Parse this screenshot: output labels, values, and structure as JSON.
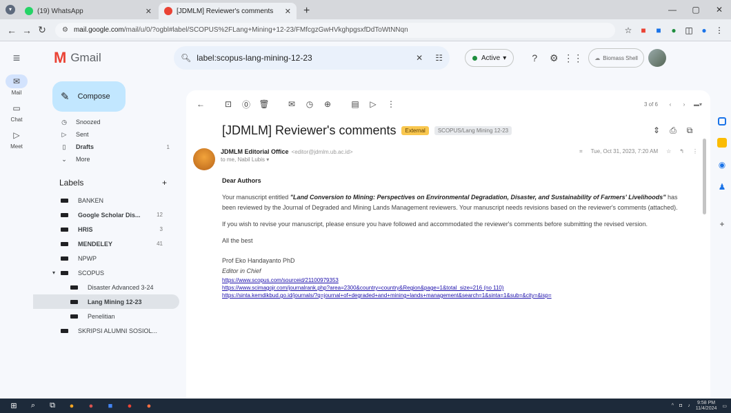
{
  "browser": {
    "tabs": [
      {
        "title": "(19) WhatsApp",
        "color": "#25d366"
      },
      {
        "title": "[JDMLM] Reviewer's comments",
        "color": "#ea4335"
      }
    ],
    "url_host": "mail.google.com",
    "url_path": "/mail/u/0/?ogbl#label/SCOPUS%2FLang+Mining+12-23/FMfcgzGwHVkghpgsxfDdToWtNNqn"
  },
  "header": {
    "logo_text": "Gmail",
    "search_query": "label:scopus-lang-mining-12-23",
    "status": "Active",
    "account_label": "Biomass Shell"
  },
  "rail": [
    {
      "label": "Mail",
      "icon": "mail-icon"
    },
    {
      "label": "Chat",
      "icon": "chat-icon"
    },
    {
      "label": "Meet",
      "icon": "video-icon"
    }
  ],
  "compose_label": "Compose",
  "nav": [
    {
      "icon": "snooze-icon",
      "label": "Snoozed",
      "count": ""
    },
    {
      "icon": "send-icon",
      "label": "Sent",
      "count": ""
    },
    {
      "icon": "draft-icon",
      "label": "Drafts",
      "count": "1"
    },
    {
      "icon": "more-icon",
      "label": "More",
      "count": ""
    }
  ],
  "labels_heading": "Labels",
  "labels": [
    {
      "name": "BANKEN",
      "count": "",
      "bold": false
    },
    {
      "name": "Google Scholar Dis...",
      "count": "12",
      "bold": true
    },
    {
      "name": "HRIS",
      "count": "3",
      "bold": true
    },
    {
      "name": "MENDELEY",
      "count": "41",
      "bold": true
    },
    {
      "name": "NPWP",
      "count": "",
      "bold": false
    },
    {
      "name": "SCOPUS",
      "count": "",
      "bold": false
    },
    {
      "name": "Disaster Advanced 3-24",
      "count": "",
      "bold": false
    },
    {
      "name": "Lang Mining 12-23",
      "count": "",
      "bold": true
    },
    {
      "name": "Penelitian",
      "count": "",
      "bold": false
    },
    {
      "name": "SKRIPSI ALUMNI SOSIOL...",
      "count": "",
      "bold": false
    }
  ],
  "email": {
    "pagination": "3 of 6",
    "subject": "[JDMLM] Reviewer's comments",
    "chip_external": "External",
    "chip_label": "SCOPUS/Lang Mining 12-23",
    "sender_name": "JDMLM Editorial Office",
    "sender_email": "<editor@jdmlm.ub.ac.id>",
    "to_line": "to me, Nabil Lubis",
    "date": "Tue, Oct 31, 2023, 7:20 AM",
    "greeting": "Dear Authors",
    "p1_a": "Your manuscript entitled ",
    "p1_title": "\"Land Conversion to Mining: Perspectives on Environmental Degradation, Disaster, and Sustainability of Farmers' Livelihoods\"",
    "p1_b": " has been reviewed by the Journal of Degraded and Mining Lands Management reviewers. Your manuscript needs revisions based on the reviewer's comments (attached).",
    "p2": "If you wish to revise your manuscript, please ensure you have followed and accommodated the reviewer's comments before submitting the revised version.",
    "p3": "All the best",
    "sig_name": "Prof Eko Handayanto PhD",
    "sig_role": "Editor in Chief",
    "links": [
      "https://www.scopus.com/sourceid/21100979353",
      "https://www.scimagojr.com/journalrank.php?area=2300&country=country&Region&page=1&total_size=216 (no 110)",
      "https://sinta.kemdikbud.go.id/journals/?q=journal+of+degraded+and+mining+lands+management&search=1&sinta=1&sub=&city=&isp="
    ]
  },
  "taskbar": {
    "time": "9:58 PM",
    "date": "11/4/2024"
  }
}
